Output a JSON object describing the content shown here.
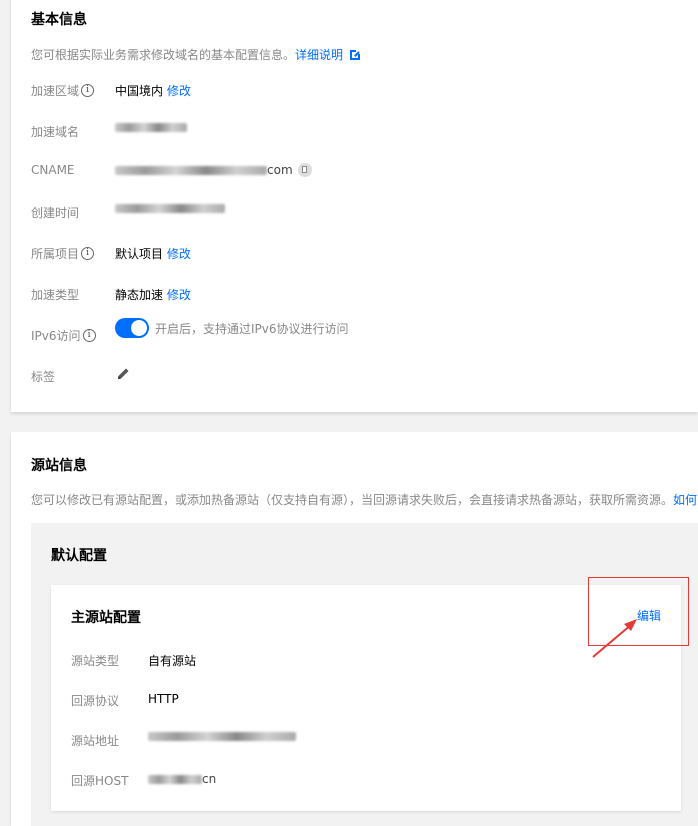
{
  "basic": {
    "title": "基本信息",
    "description": "您可根据实际业务需求修改域名的基本配置信息。",
    "doc_link": "详细说明",
    "rows": {
      "region": {
        "label": "加速区域",
        "value": "中国境内",
        "action": "修改"
      },
      "domain": {
        "label": "加速域名"
      },
      "cname": {
        "label": "CNAME",
        "value_suffix": "com"
      },
      "created": {
        "label": "创建时间"
      },
      "project": {
        "label": "所属项目",
        "value": "默认项目",
        "action": "修改"
      },
      "type": {
        "label": "加速类型",
        "value": "静态加速",
        "action": "修改"
      },
      "ipv6": {
        "label": "IPv6访问",
        "value": "开启后，支持通过IPv6协议进行访问",
        "enabled": true
      },
      "tags": {
        "label": "标签"
      }
    }
  },
  "origin": {
    "title": "源站信息",
    "description": "您可以修改已有源站配置，或添加热备源站（仅支持自有源），当回源请求失败后，会直接请求热备源站，获取所需资源。",
    "desc_link": "如何",
    "default_config": "默认配置",
    "main_config": {
      "title": "主源站配置",
      "edit": "编辑",
      "rows": {
        "type": {
          "label": "源站类型",
          "value": "自有源站"
        },
        "protocol": {
          "label": "回源协议",
          "value": "HTTP"
        },
        "address": {
          "label": "源站地址"
        },
        "host": {
          "label": "回源HOST",
          "value_suffix": "cn"
        }
      }
    }
  },
  "colors": {
    "accent": "#006eff",
    "annotation": "#e53935"
  }
}
